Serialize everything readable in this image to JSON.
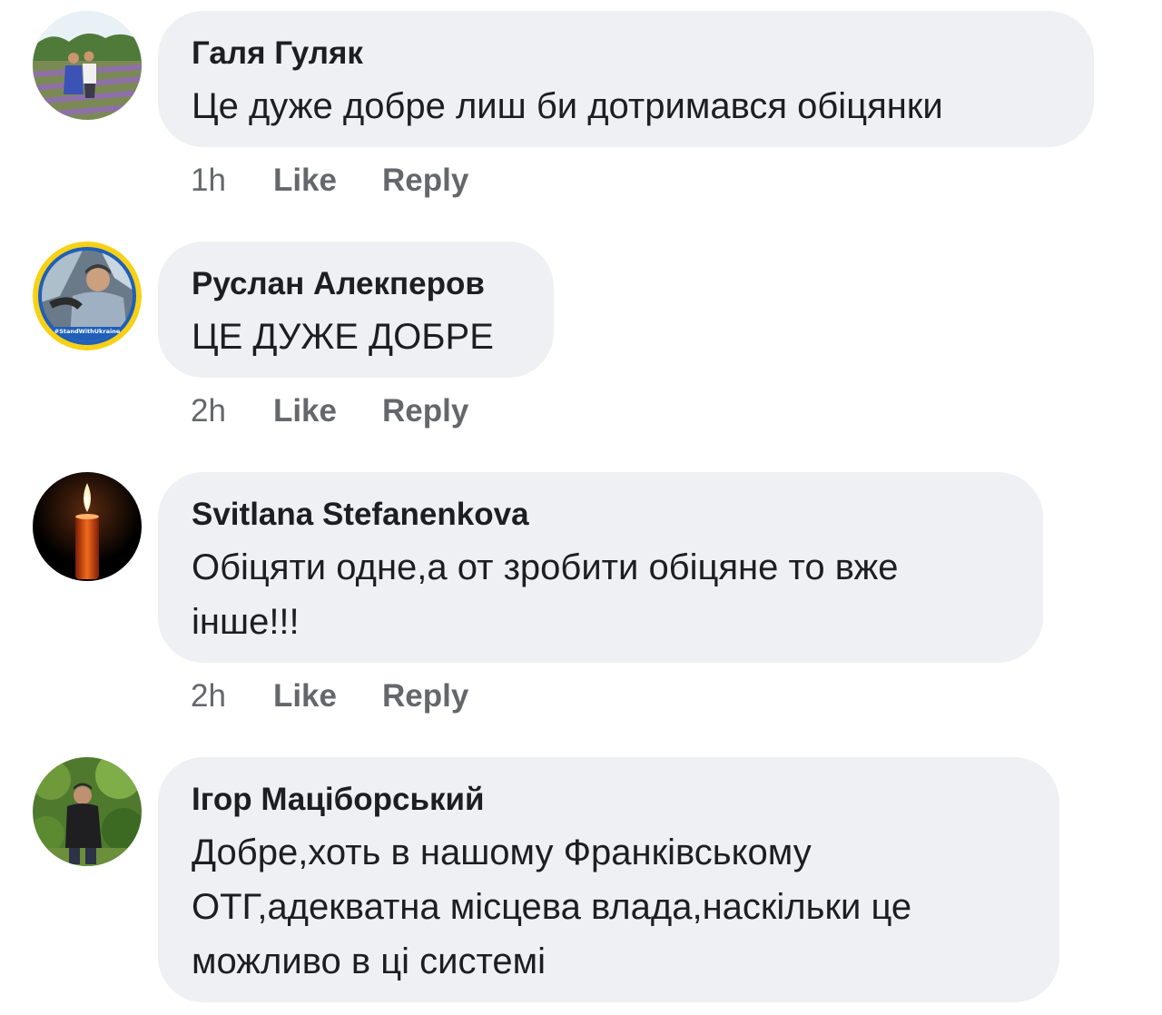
{
  "comments": [
    {
      "author": "Галя Гуляк",
      "text": "Це дуже добре лиш би дотримався обіцянки",
      "time": "1h",
      "like_label": "Like",
      "reply_label": "Reply",
      "avatar_icon": "person-photo-avatar"
    },
    {
      "author": "Руслан Алекперов",
      "text": "ЦЕ ДУЖЕ ДОБРЕ",
      "time": "2h",
      "like_label": "Like",
      "reply_label": "Reply",
      "avatar_icon": "person-photo-avatar",
      "avatar_frame_text": "#StandWithUkraine"
    },
    {
      "author": "Svitlana Stefanenkova",
      "text": "Обіцяти одне,а от зробити обіцяне то вже\nінше!!!",
      "time": "2h",
      "like_label": "Like",
      "reply_label": "Reply",
      "avatar_icon": "candle-avatar"
    },
    {
      "author": "Ігор Маціборський",
      "text": "Добре,хоть в нашому Франківському\nОТГ,адекватна місцева влада,наскільки це\nможливо в ці системі",
      "time": "",
      "like_label": "",
      "reply_label": "",
      "avatar_icon": "person-photo-avatar"
    }
  ],
  "colors": {
    "bubble": "#eff0f3",
    "text": "#1c1e21",
    "meta": "#65676b",
    "ukraine_blue": "#1f5fb8",
    "ukraine_yellow": "#f7d117"
  }
}
